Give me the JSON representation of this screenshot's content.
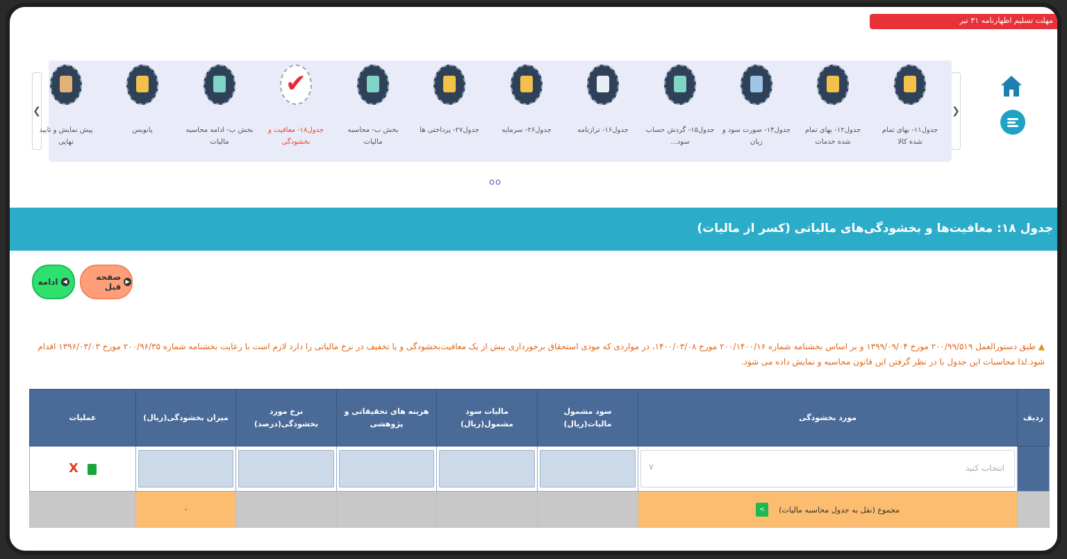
{
  "top_strip": {
    "text": "مهلت تسلیم اظهارنامه ۳۱ تیر"
  },
  "carousel": {
    "prev_arrow": "❯",
    "next_arrow": "❮",
    "page_dots": "oo",
    "steps": [
      {
        "label": "جدول۱۱- بهای تمام شده کالا",
        "icon": "invoice-icon",
        "color": "#f3c04c",
        "active": false
      },
      {
        "label": "جدول۱۲- بهای تمام شده خدمات",
        "icon": "building-hand-icon",
        "color": "#f3c04c",
        "active": false
      },
      {
        "label": "جدول۱۴- صورت سود و زیان",
        "icon": "balance-scale-icon",
        "color": "#9ec5e8",
        "active": false
      },
      {
        "label": "جدول۱۵- گردش حساب سود...",
        "icon": "flow-icon",
        "color": "#7fd3c7",
        "active": false
      },
      {
        "label": "جدول۱۶- ترازنامه",
        "icon": "calculator-icon",
        "color": "#e9eef5",
        "active": false
      },
      {
        "label": "جدول۲۶- سرمایه",
        "icon": "money-bag-icon",
        "color": "#f3c04c",
        "active": false
      },
      {
        "label": "جدول۲۷- پرداختی ها",
        "icon": "payments-icon",
        "color": "#f3c04c",
        "active": false
      },
      {
        "label": "بخش ب- محاسبه مالیات",
        "icon": "tax-monitor-icon",
        "color": "#7fd3c7",
        "active": false
      },
      {
        "label": "جدول۱۸- معافیت و بخشودگی",
        "icon": "checkmark-icon",
        "color": "#e8283a",
        "active": true
      },
      {
        "label": "بخش ب- ادامه محاسبه مالیات",
        "icon": "tax-monitor-icon",
        "color": "#7fd3c7",
        "active": false
      },
      {
        "label": "پانویس",
        "icon": "person-document-icon",
        "color": "#f3c04c",
        "active": false
      },
      {
        "label": "پیش نمایش و تایید نهایی",
        "icon": "stamp-icon",
        "color": "#e3b07a",
        "active": false
      }
    ]
  },
  "section": {
    "title": "جدول ۱۸: معافیت‌ها و بخشودگی‌های مالیاتی (کسر از مالیات)"
  },
  "nav_buttons": {
    "continue": "ادامه",
    "prev_page": "صفحه قبل"
  },
  "notice": "طبق دستورالعمل ۲۰۰/۹۹/۵۱۹ مورخ ۱۳۹۹/۰۹/۰۴ و بر اساس بخشنامه شماره ۲۰۰/۱۴۰۰/۱۶ مورخ ۱۴۰۰/۰۳/۰۸، در مواردی که مودی استحقاق برخورداری بیش از یک معافیت‌بخشودگی و یا تخفیف در نرخ مالیاتی را دارد لازم است با رعایت بخشنامه شماره ۲۰۰/۹۶/۳۵ مورخ ۱۳۹۶/۰۳/۰۳ اقدام شود.لذا محاسبات این جدول با در نظر گرفتن این قانون محاسبه و نمایش داده می شود.",
  "table": {
    "headers": [
      "ردیف",
      "مورد بخشودگی",
      "سود مشمول مالیات(ریال)",
      "مالیات سود مشمول(ریال)",
      "هزینه های تحقیقاتی و پژوهشی",
      "نرخ مورد بخشودگی(درصد)",
      "میزان بخشودگی(ریال)",
      "عملیات"
    ],
    "select_placeholder": "انتخاب کنید",
    "delete_glyph": "X",
    "sum_label": "مجموع (نقل به جدول محاسبه مالیات)",
    "sum_value": "۰"
  }
}
